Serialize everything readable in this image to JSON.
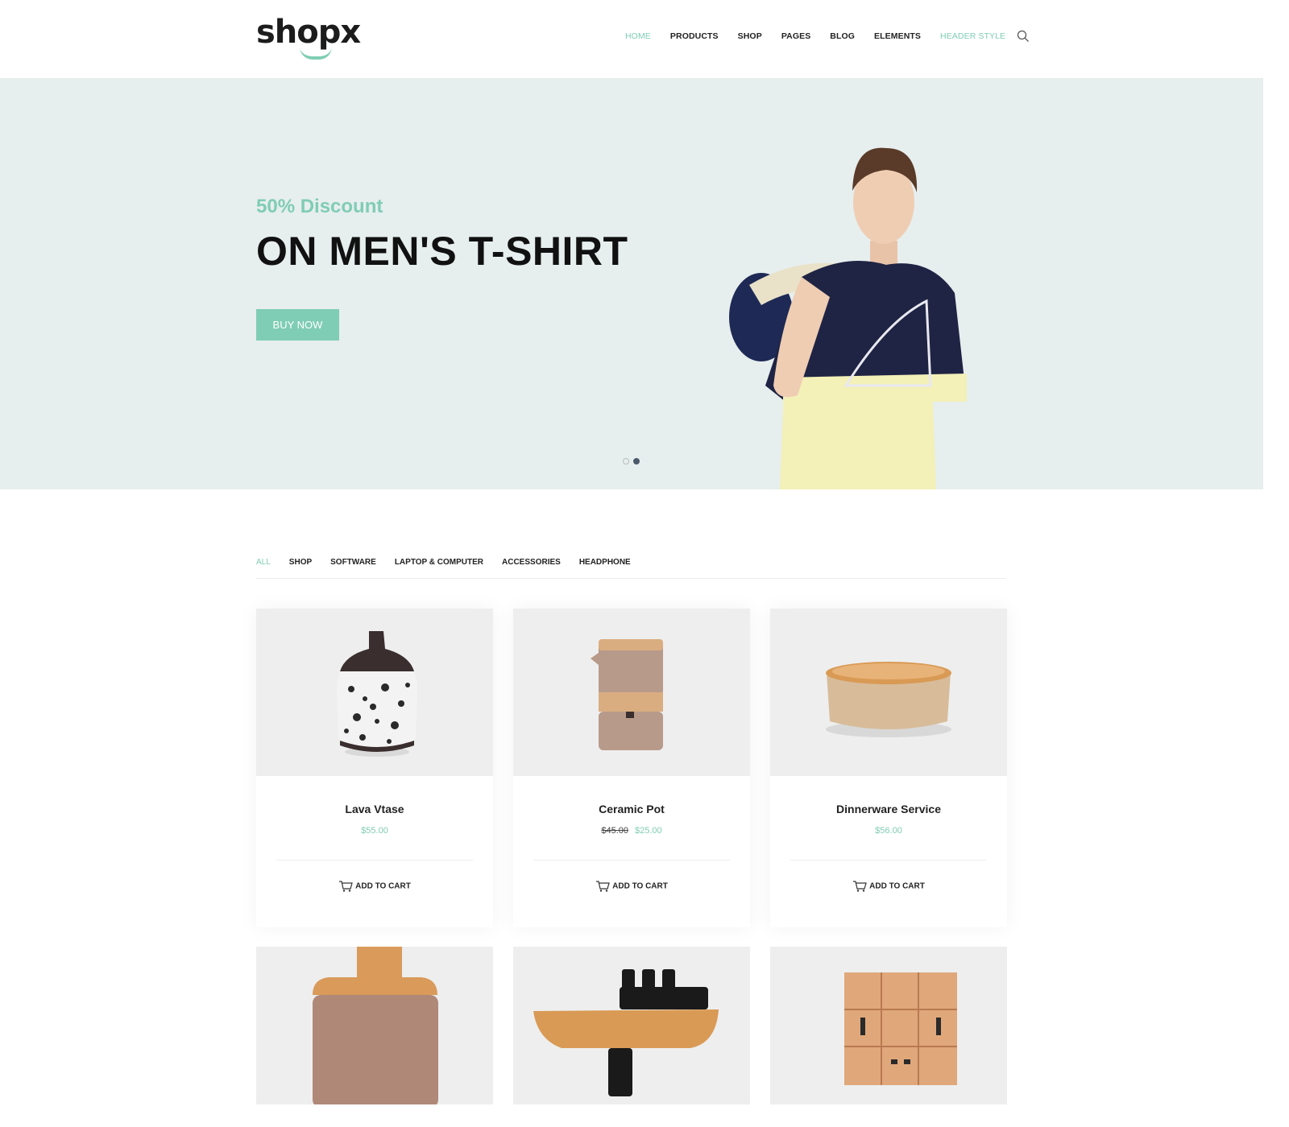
{
  "brand": {
    "logo_text": "shopx"
  },
  "nav": {
    "items": [
      {
        "label": "HOME"
      },
      {
        "label": "PRODUCTS"
      },
      {
        "label": "SHOP"
      },
      {
        "label": "PAGES"
      },
      {
        "label": "BLOG"
      },
      {
        "label": "ELEMENTS"
      },
      {
        "label": "HEADER STYLE"
      }
    ],
    "search_icon": "search-icon"
  },
  "hero": {
    "subtitle": "50% Discount",
    "title": "ON MEN'S T-SHIRT",
    "button_label": "BUY NOW",
    "slides": 2,
    "active_slide": 2
  },
  "filters": {
    "tabs": [
      {
        "label": "ALL"
      },
      {
        "label": "SHOP"
      },
      {
        "label": "SOFTWARE"
      },
      {
        "label": "LAPTOP & COMPUTER"
      },
      {
        "label": "ACCESSORIES"
      },
      {
        "label": "HEADPHONE"
      }
    ],
    "active": "ALL"
  },
  "products": [
    {
      "name": "Lava Vtase",
      "price": "$55.00",
      "old_price": "",
      "cart_label": "ADD TO CART"
    },
    {
      "name": "Ceramic Pot",
      "price": "$25.00",
      "old_price": "$45.00",
      "cart_label": "ADD TO CART"
    },
    {
      "name": "Dinnerware Service",
      "price": "$56.00",
      "old_price": "",
      "cart_label": "ADD TO CART"
    }
  ],
  "colors": {
    "accent": "#7fcdb4",
    "hero_bg": "#e7eeee",
    "card_img_bg": "#eeeeee"
  }
}
